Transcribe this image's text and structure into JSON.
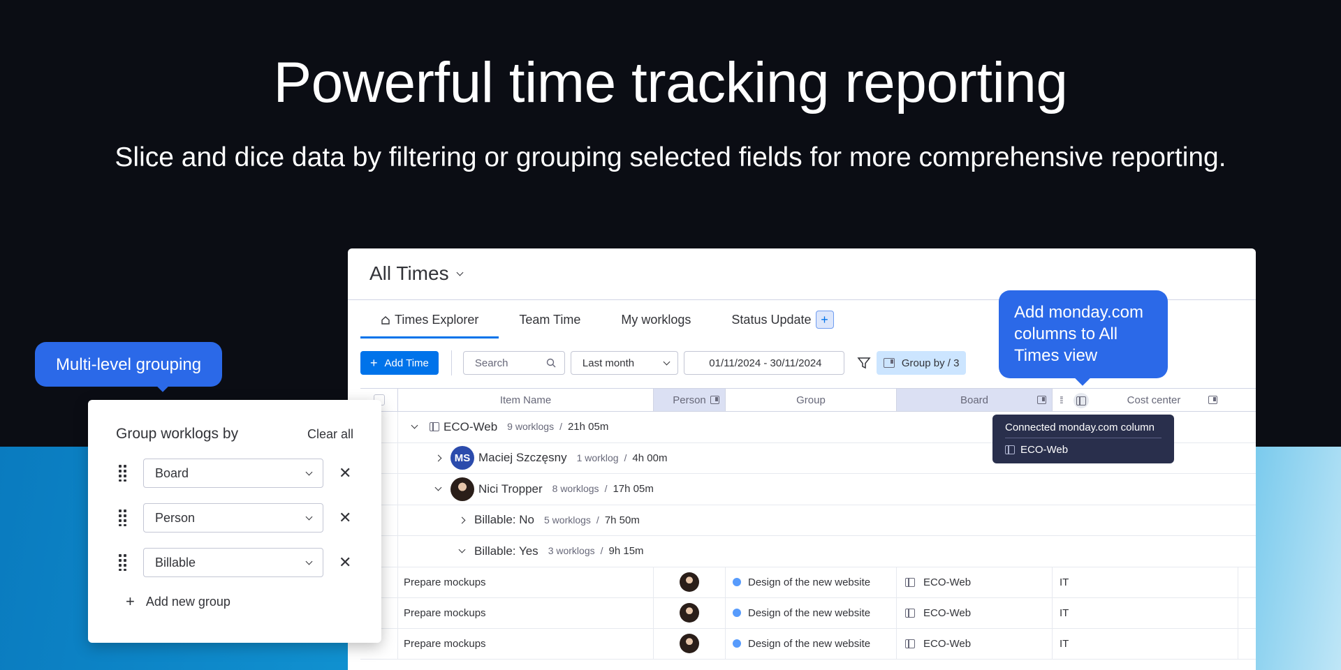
{
  "hero": {
    "title": "Powerful time tracking reporting",
    "subtitle": "Slice and dice data by filtering or grouping selected fields for more comprehensive reporting."
  },
  "app": {
    "title": "All Times",
    "tabs": [
      {
        "label": "Times Explorer",
        "active": true,
        "icon": "home-icon"
      },
      {
        "label": "Team Time"
      },
      {
        "label": "My worklogs"
      },
      {
        "label": "Status Update"
      }
    ],
    "tab_add": "+",
    "toolbar": {
      "add_time": "Add Time",
      "search_placeholder": "Search",
      "period": "Last month",
      "date_range": "01/11/2024 - 30/11/2024",
      "group_by": "Group by / 3"
    },
    "columns": [
      "Item Name",
      "Person",
      "Group",
      "Board",
      "Cost center"
    ],
    "groups": [
      {
        "name": "ECO-Web",
        "count": "9 worklogs",
        "duration": "21h 05m"
      },
      {
        "name": "Maciej Szczęsny",
        "initials": "MS",
        "count": "1 worklog",
        "duration": "4h 00m"
      },
      {
        "name": "Nici Tropper",
        "count": "8 worklogs",
        "duration": "17h 05m"
      },
      {
        "name": "Billable: No",
        "count": "5 worklogs",
        "duration": "7h 50m"
      },
      {
        "name": "Billable: Yes",
        "count": "3 worklogs",
        "duration": "9h 15m"
      }
    ],
    "rows": [
      {
        "item": "Prepare mockups",
        "group": "Design of the new website",
        "board": "ECO-Web",
        "cost_center": "IT"
      },
      {
        "item": "Prepare mockups",
        "group": "Design of the new website",
        "board": "ECO-Web",
        "cost_center": "IT"
      },
      {
        "item": "Prepare mockups",
        "group": "Design of the new website",
        "board": "ECO-Web",
        "cost_center": "IT"
      }
    ]
  },
  "tooltips": {
    "grouping": "Multi-level grouping",
    "columns": "Add monday.com columns to All Times view",
    "connected_title": "Connected monday.com column",
    "connected_value": "ECO-Web"
  },
  "group_card": {
    "title": "Group worklogs by",
    "clear": "Clear all",
    "fields": [
      "Board",
      "Person",
      "Billable"
    ],
    "add": "Add new group"
  },
  "colors": {
    "accent": "#0073ea",
    "bubble": "#2b69e8",
    "tooltip_dark": "#292f4c"
  }
}
